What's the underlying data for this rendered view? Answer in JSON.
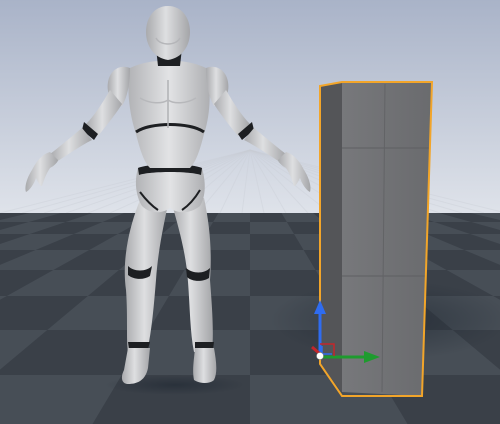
{
  "viewport": {
    "sky_top": "#a9b3c8",
    "sky_horizon": "#dfe3ea",
    "floor_dark": "#3a4048",
    "floor_light": "#525963",
    "selection_outline": "#f2a52a",
    "gizmo": {
      "x_axis_color": "#1e9b2e",
      "z_axis_color": "#2f6cf0",
      "y_axis_color": "#c3262b"
    }
  },
  "scene_objects": [
    {
      "name": "Mannequin",
      "selected": false,
      "color": "#cfd0d3",
      "joint_color": "#1d1f22"
    },
    {
      "name": "Cube",
      "selected": true,
      "color": "#6e6f72"
    }
  ]
}
